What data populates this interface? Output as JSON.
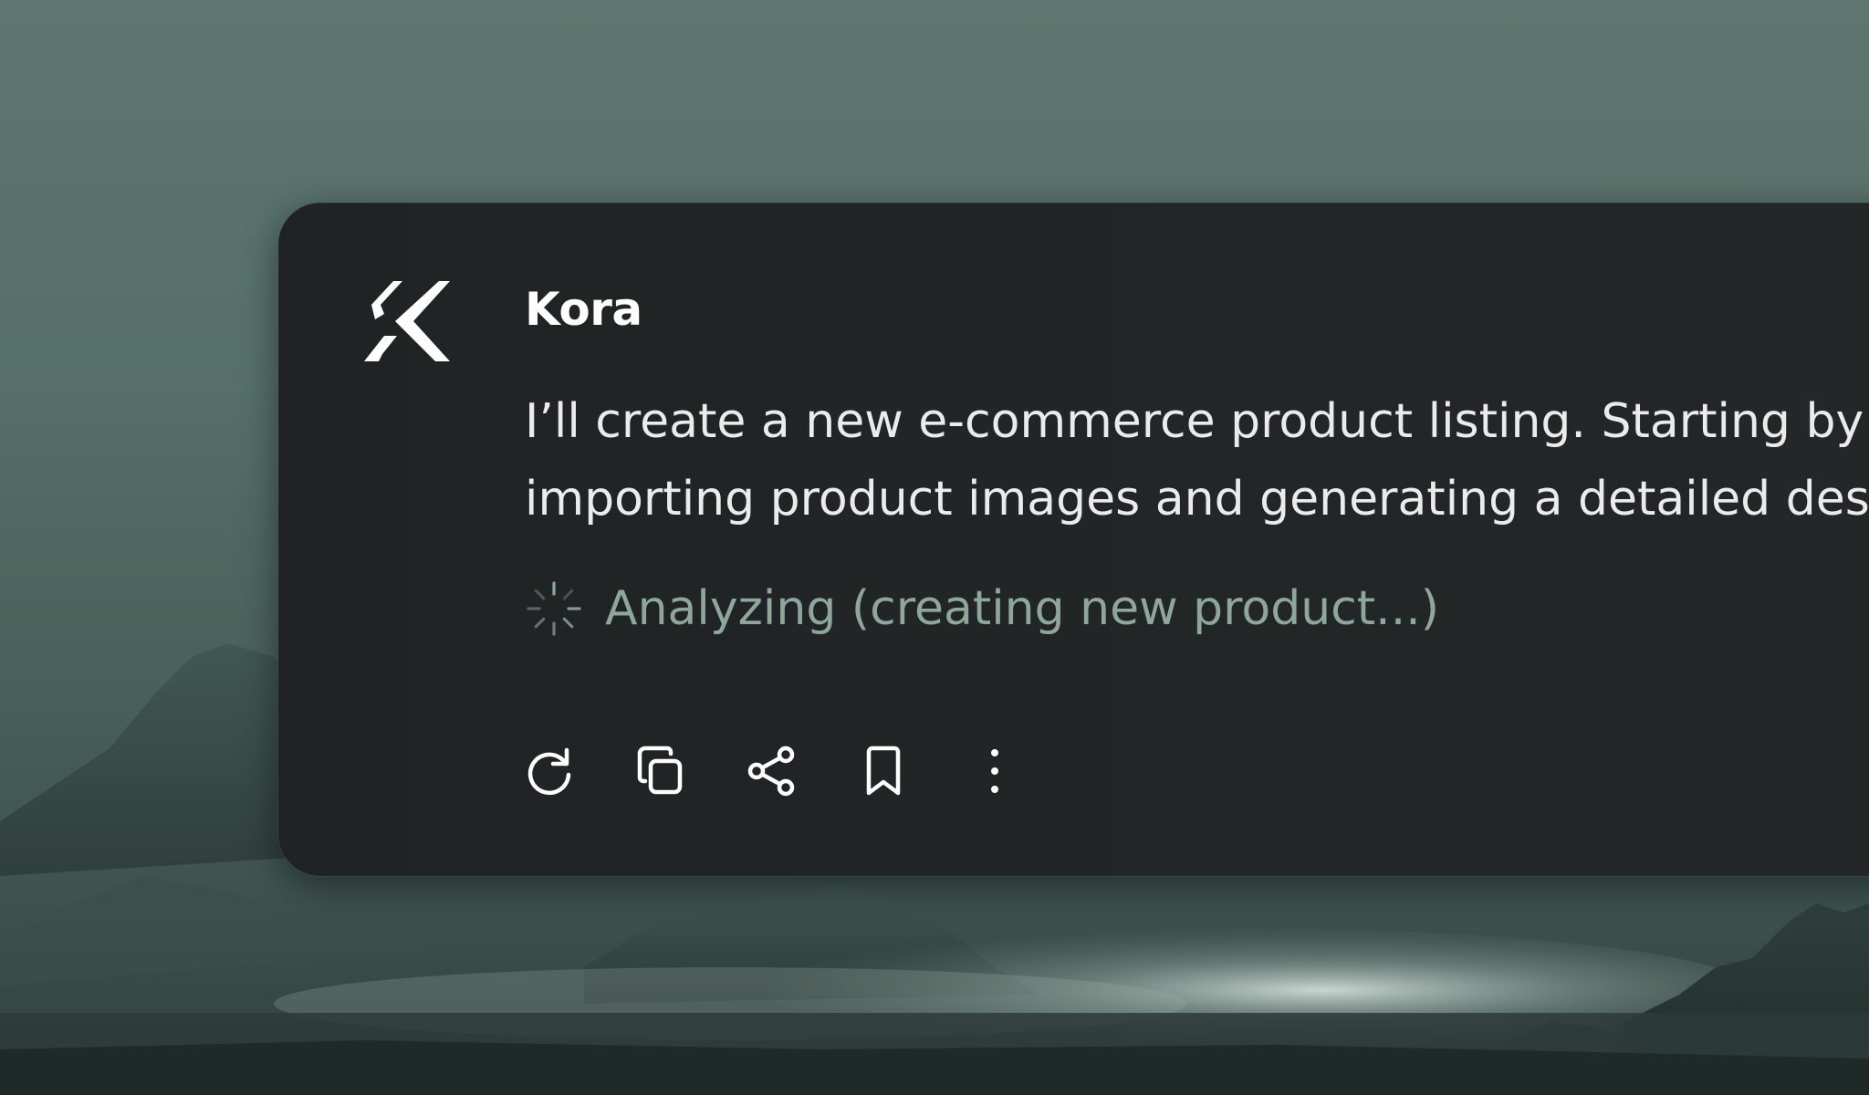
{
  "assistant": {
    "name": "Kora",
    "logo_icon": "kora-logo-icon"
  },
  "message": {
    "line1": "I’ll create a new e-commerce product listing. Starting by",
    "line2": "importing product images and generating a detailed des"
  },
  "status": {
    "icon": "loading-spinner-icon",
    "text": "Analyzing (creating new product...)"
  },
  "actions": [
    {
      "icon": "retry-icon"
    },
    {
      "icon": "copy-icon"
    },
    {
      "icon": "share-icon"
    },
    {
      "icon": "bookmark-icon"
    },
    {
      "icon": "more-vertical-icon"
    }
  ],
  "colors": {
    "card_background": "#212526",
    "title_text": "#ffffff",
    "body_text": "#e9ecea",
    "status_text": "#8fa69b",
    "backdrop": "#5d766f"
  }
}
